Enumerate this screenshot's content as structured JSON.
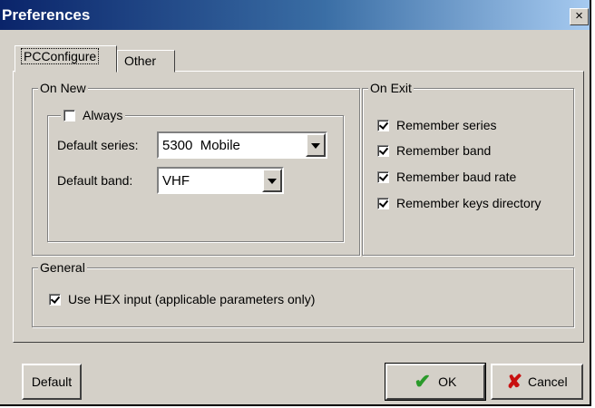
{
  "window": {
    "title": "Preferences",
    "close_glyph": "×"
  },
  "tabs": [
    {
      "label": "PCConfigure",
      "active": true
    },
    {
      "label": "Other",
      "active": false
    }
  ],
  "on_new": {
    "legend": "On New",
    "always": {
      "label": "Always",
      "checked": false
    },
    "default_series": {
      "label": "Default series:",
      "value": "5300  Mobile"
    },
    "default_band": {
      "label": "Default band:",
      "value": "VHF"
    }
  },
  "on_exit": {
    "legend": "On Exit",
    "items": [
      {
        "label": "Remember series",
        "checked": true
      },
      {
        "label": "Remember band",
        "checked": true
      },
      {
        "label": "Remember baud rate",
        "checked": true
      },
      {
        "label": "Remember keys directory",
        "checked": true
      }
    ]
  },
  "general": {
    "legend": "General",
    "hex_input": {
      "label": "Use HEX input (applicable parameters only)",
      "checked": true
    }
  },
  "buttons": {
    "default_label": "Default",
    "ok_label": "OK",
    "cancel_label": "Cancel"
  },
  "icons": {
    "ok": "check-icon",
    "cancel": "x-icon",
    "close": "close-icon"
  },
  "colors": {
    "title_start": "#0a246a",
    "title_end": "#a6caf0",
    "face": "#d4d0c8",
    "ok_green": "#2a9a2a",
    "cancel_red": "#c81010"
  }
}
